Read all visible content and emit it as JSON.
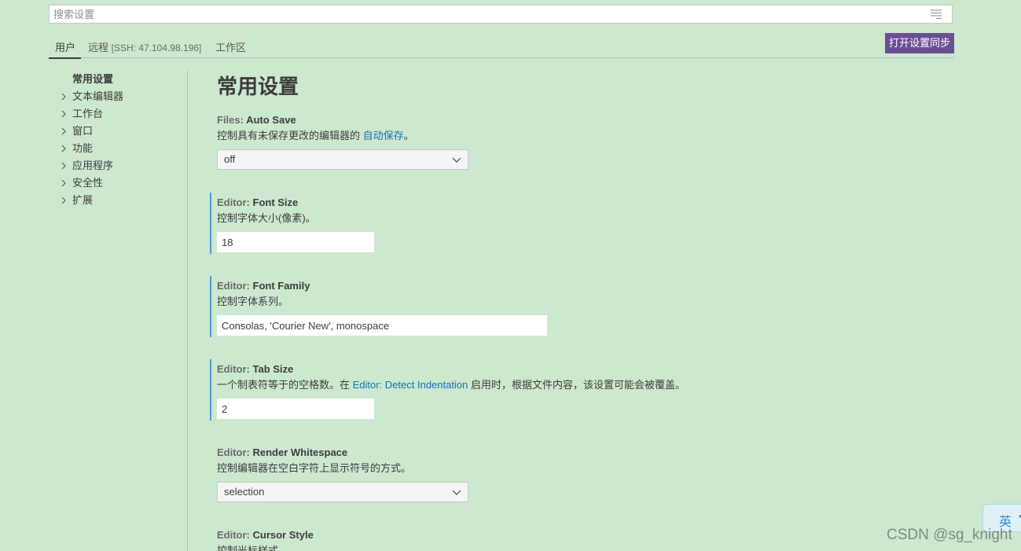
{
  "search": {
    "placeholder": "搜索设置"
  },
  "tabs": [
    {
      "label": "用户"
    },
    {
      "label": "远程",
      "detail": "[SSH: 47.104.98.196]"
    },
    {
      "label": "工作区"
    }
  ],
  "sync_button": "打开设置同步",
  "toc": {
    "items": [
      {
        "label": "常用设置"
      },
      {
        "label": "文本编辑器"
      },
      {
        "label": "工作台"
      },
      {
        "label": "窗口"
      },
      {
        "label": "功能"
      },
      {
        "label": "应用程序"
      },
      {
        "label": "安全性"
      },
      {
        "label": "扩展"
      }
    ]
  },
  "main": {
    "title": "常用设置",
    "settings": [
      {
        "category": "Files: ",
        "name": "Auto Save",
        "desc_before": "控制具有未保存更改的编辑器的 ",
        "desc_link": "自动保存",
        "desc_after": "。",
        "value": "off"
      },
      {
        "category": "Editor: ",
        "name": "Font Size",
        "desc": "控制字体大小(像素)。",
        "value": "18"
      },
      {
        "category": "Editor: ",
        "name": "Font Family",
        "desc": "控制字体系列。",
        "value": "Consolas, 'Courier New', monospace"
      },
      {
        "category": "Editor: ",
        "name": "Tab Size",
        "desc_before": "一个制表符等于的空格数。在 ",
        "desc_link": "Editor: Detect Indentation",
        "desc_after": " 启用时，根据文件内容，该设置可能会被覆盖。",
        "value": "2"
      },
      {
        "category": "Editor: ",
        "name": "Render Whitespace",
        "desc": "控制编辑器在空白字符上显示符号的方式。",
        "value": "selection"
      },
      {
        "category": "Editor: ",
        "name": "Cursor Style",
        "desc": "控制光标样式。"
      }
    ]
  },
  "ime": {
    "label": "英"
  },
  "watermark": "CSDN @sg_knight",
  "colors": {
    "background": "#cce8cf",
    "sync_button": "#6c4e96",
    "link": "#1a6fb5",
    "modified_bar": "#4f9bd0"
  }
}
